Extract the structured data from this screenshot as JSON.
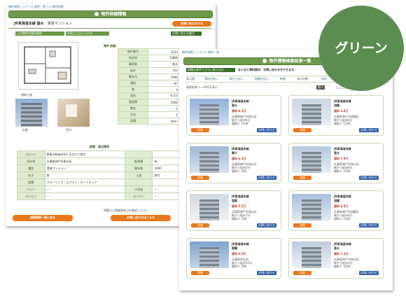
{
  "badge": {
    "label": "グリーン"
  },
  "back_window": {
    "breadcrumb": "物件検索トップ >> 物件一覧 >> 物件詳細",
    "title": "物件詳細情報",
    "property_name": "JR東海道本線 垂水",
    "property_type": "賃貸マンション",
    "top_button": "お問い合わせする",
    "action_buttons": [
      "この物件を資料請求",
      "お気に入りに入れる"
    ],
    "contact_label": "お問い合わせ番号",
    "section_label": "物件 詳細",
    "info_rows": [
      {
        "k": "物件番号",
        "v": "1023"
      },
      {
        "k": "所在地",
        "v": "兵庫県"
      },
      {
        "k": "最寄駅",
        "v": "垂水"
      },
      {
        "k": "徒歩",
        "v": "6分"
      },
      {
        "k": "築年月",
        "v": "1990"
      },
      {
        "k": "構造",
        "v": "RC"
      },
      {
        "k": "階",
        "v": "4"
      },
      {
        "k": "賃料",
        "v": "6.5万"
      },
      {
        "k": "管理費",
        "v": "5000"
      },
      {
        "k": "敷金",
        "v": "1"
      },
      {
        "k": "礼金",
        "v": "1"
      },
      {
        "k": "面積",
        "v": "40m²"
      }
    ],
    "photo_captions": [
      "間取り図",
      "外観",
      "室内"
    ],
    "detail_title": "設備・周辺環境",
    "detail_rows": [
      {
        "k1": "コメント",
        "v1": "JR垂水駅徒歩6分 日当たり良好",
        "k2": "",
        "v2": ""
      },
      {
        "k1": "所在地",
        "v1": "兵庫県神戸市垂水区",
        "k2": "駐車場",
        "v2": "有"
      },
      {
        "k1": "種別",
        "v1": "賃貸マンション",
        "k2": "築年数",
        "v2": "1990"
      },
      {
        "k1": "向き",
        "v1": "南",
        "k2": "入居",
        "v2": "即可"
      },
      {
        "k1": "設備",
        "v1": "フローリング・エアコン・オートロック",
        "k2": "",
        "v2": ""
      },
      {
        "k1": "ペット",
        "v1": "—",
        "k2": "小学校",
        "v2": "—"
      },
      {
        "k1": "コンビニ",
        "v1": "—",
        "k2": "スーパー",
        "v2": "—"
      }
    ],
    "note": "掲載日と情報更新日を確認ください",
    "bottom_buttons": [
      "検索結果一覧に戻る",
      "お問い合わせはこちら"
    ]
  },
  "front_window": {
    "breadcrumb": "物件検索トップ >> 物件一覧",
    "title": "物件情報検索結果一覧",
    "tab_label": "詳細な条件でさらに絞り込む",
    "tab_note": "まとめて資料請求・お問い合わせができます。",
    "filter_label": "表示順",
    "filters": [
      "賃料が安い",
      "駅から近い",
      "面積が広い",
      "新着"
    ],
    "sort_label": "表示件数",
    "sort_options": [
      "10件",
      "20件"
    ],
    "result_label": "検索結果 1〜10件を表示",
    "pagination": {
      "prev": "前へ",
      "page": "1 2 3 4 5",
      "next": "次へ"
    },
    "cards": [
      {
        "line": "JR東海道本線",
        "station": "垂水",
        "price": "賃料 6.5万",
        "addr": "兵庫県神戸市垂水区",
        "walk": "駅から徒歩6分",
        "layout": "間取り 2LDK",
        "btn": "詳細",
        "btn2": "お問い合わせ"
      },
      {
        "line": "JR東海道本線",
        "station": "須磨",
        "price": "賃料 5.8万",
        "addr": "兵庫県神戸市須磨区",
        "walk": "駅から徒歩8分",
        "layout": "間取り 1LDK",
        "btn": "詳細",
        "btn2": "お問い合わせ"
      },
      {
        "line": "JR東海道本線",
        "station": "舞子",
        "price": "賃料 6.2万",
        "addr": "兵庫県神戸市垂水区",
        "walk": "駅から徒歩5分",
        "layout": "間取り 2DK",
        "btn": "詳細",
        "btn2": "お問い合わせ"
      },
      {
        "line": "JR東海道本線",
        "station": "垂水",
        "price": "賃料 7.0万",
        "addr": "兵庫県神戸市垂水区",
        "walk": "駅から徒歩9分",
        "layout": "間取り 2LDK",
        "btn": "詳細",
        "btn2": "お問い合わせ"
      },
      {
        "line": "JR東海道本線",
        "station": "塩屋",
        "price": "賃料 5.5万",
        "addr": "兵庫県神戸市垂水区",
        "walk": "駅から徒歩7分",
        "layout": "間取り 1DK",
        "btn": "詳細",
        "btn2": "お問い合わせ"
      },
      {
        "line": "JR東海道本線",
        "station": "須磨",
        "price": "賃料 6.8万",
        "addr": "兵庫県神戸市須磨区",
        "walk": "駅から徒歩4分",
        "layout": "間取り 2LDK",
        "btn": "詳細",
        "btn2": "お問い合わせ"
      },
      {
        "line": "JR東海道本線",
        "station": "朝霧",
        "price": "賃料 6.0万",
        "addr": "兵庫県明石市",
        "walk": "駅から徒歩10分",
        "layout": "間取り 2DK",
        "btn": "詳細",
        "btn2": "お問い合わせ"
      },
      {
        "line": "JR東海道本線",
        "station": "垂水",
        "price": "賃料 7.3万",
        "addr": "兵庫県神戸市垂水区",
        "walk": "駅から徒歩3分",
        "layout": "間取り 3LDK",
        "btn": "詳細",
        "btn2": "お問い合わせ"
      }
    ]
  },
  "colors": {
    "green": "#6f9a4c",
    "orange": "#e8781c",
    "badge": "#5c8d50",
    "link": "#3a6e8a"
  }
}
